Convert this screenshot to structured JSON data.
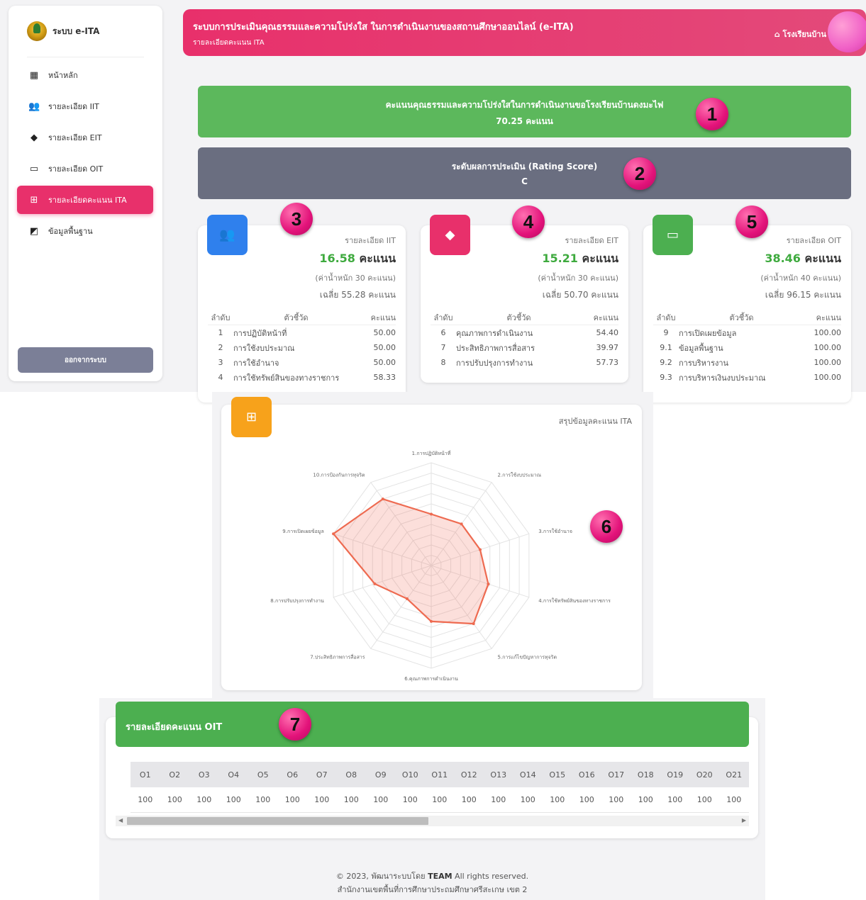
{
  "sidebar": {
    "brand": "ระบบ e-ITA",
    "items": [
      {
        "label": "หน้าหลัก",
        "icon": "dashboard-icon"
      },
      {
        "label": "รายละเอียด IIT",
        "icon": "users-icon"
      },
      {
        "label": "รายละเอียด EIT",
        "icon": "gem-icon"
      },
      {
        "label": "รายละเอียด OIT",
        "icon": "devices-icon"
      },
      {
        "label": "รายละเอียดคะแนน ITA",
        "icon": "grid-icon"
      },
      {
        "label": "ข้อมูลพื้นฐาน",
        "icon": "chart-icon"
      }
    ],
    "logout": "ออกจากระบบ"
  },
  "header": {
    "title": "ระบบการประเมินคุณธรรมและความโปร่งใส ในการดำเนินงานของสถานศึกษาออนไลน์ (e-ITA)",
    "subtitle": "รายละเอียดคะแนน ITA",
    "school": "โรงเรียนบ้าน"
  },
  "score_banner": {
    "line1": "คะแนนคุณธรรมและความโปร่งใสในการดำเนินงานขอโรงเรียนบ้านดงมะไฟ",
    "line2": "70.25 คะแนน"
  },
  "rating_banner": {
    "line1": "ระดับผลการประเมิน (Rating Score)",
    "line2": "C"
  },
  "markers": [
    "1",
    "2",
    "3",
    "4",
    "5",
    "6",
    "7"
  ],
  "table_headers": {
    "rank": "ลำดับ",
    "indicator": "ตัวชี้วัด",
    "score": "คะแนน"
  },
  "cards": [
    {
      "caption": "รายละเอียด IIT",
      "score": "16.58",
      "score_unit": "คะแนน",
      "weight": "(ค่าน้ำหนัก 30 คะแนน)",
      "average": "เฉลี่ย 55.28 คะแนน",
      "color": "#2f80ed",
      "rows": [
        {
          "no": "1",
          "name": "การปฏิบัติหน้าที่",
          "score": "50.00"
        },
        {
          "no": "2",
          "name": "การใช้งบประมาณ",
          "score": "50.00"
        },
        {
          "no": "3",
          "name": "การใช้อำนาจ",
          "score": "50.00"
        },
        {
          "no": "4",
          "name": "การใช้ทรัพย์สินของทางราชการ",
          "score": "58.33"
        }
      ]
    },
    {
      "caption": "รายละเอียด EIT",
      "score": "15.21",
      "score_unit": "คะแนน",
      "weight": "(ค่าน้ำหนัก 30 คะแนน)",
      "average": "เฉลี่ย 50.70 คะแนน",
      "color": "#e8306b",
      "rows": [
        {
          "no": "6",
          "name": "คุณภาพการดำเนินงาน",
          "score": "54.40"
        },
        {
          "no": "7",
          "name": "ประสิทธิภาพการสื่อสาร",
          "score": "39.97"
        },
        {
          "no": "8",
          "name": "การปรับปรุงการทำงาน",
          "score": "57.73"
        }
      ]
    },
    {
      "caption": "รายละเอียด OIT",
      "score": "38.46",
      "score_unit": "คะแนน",
      "weight": "(ค่าน้ำหนัก 40 คะแนน)",
      "average": "เฉลี่ย 96.15 คะแนน",
      "color": "#4caf50",
      "rows": [
        {
          "no": "9",
          "name": "การเปิดเผยข้อมูล",
          "score": "100.00"
        },
        {
          "no": "9.1",
          "name": "ข้อมูลพื้นฐาน",
          "score": "100.00"
        },
        {
          "no": "9.2",
          "name": "การบริหารงาน",
          "score": "100.00"
        },
        {
          "no": "9.3",
          "name": "การบริหารเงินงบประมาณ",
          "score": "100.00"
        }
      ]
    }
  ],
  "radar": {
    "caption": "สรุปข้อมูลคะแนน ITA",
    "color": "#f7a21b",
    "chart_data": {
      "type": "radar",
      "categories": [
        "1.การปฏิบัติหน้าที่",
        "2.การใช้งบประมาณ",
        "3.การใช้อำนาจ",
        "4.การใช้ทรัพย์สินของทางราชการ",
        "5.การแก้ไขปัญหาการทุจริต",
        "6.คุณภาพการดำเนินงาน",
        "7.ประสิทธิภาพการสื่อสาร",
        "8.การปรับปรุงการทำงาน",
        "9.การเปิดเผยข้อมูล",
        "10.การป้องกันการทุจริต"
      ],
      "values": [
        50.0,
        50.0,
        50.0,
        58.33,
        70.0,
        54.4,
        39.97,
        57.73,
        100.0,
        80.0
      ],
      "rmax": 100
    }
  },
  "oit_table": {
    "title": "รายละเอียดคะแนน OIT",
    "columns": [
      "O1",
      "O2",
      "O3",
      "O4",
      "O5",
      "O6",
      "O7",
      "O8",
      "O9",
      "O10",
      "O11",
      "O12",
      "O13",
      "O14",
      "O15",
      "O16",
      "O17",
      "O18",
      "O19",
      "O20",
      "O21"
    ],
    "values": [
      "100",
      "100",
      "100",
      "100",
      "100",
      "100",
      "100",
      "100",
      "100",
      "100",
      "100",
      "100",
      "100",
      "100",
      "100",
      "100",
      "100",
      "100",
      "100",
      "100",
      "100"
    ]
  },
  "footer": {
    "prefix": "© 2023, พัฒนาระบบโดย",
    "team": "TEAM",
    "suffix": "All rights reserved.",
    "org": "สำนักงานเขตพื้นที่การศึกษาประถมศึกษาศรีสะเกษ เขต 2"
  }
}
